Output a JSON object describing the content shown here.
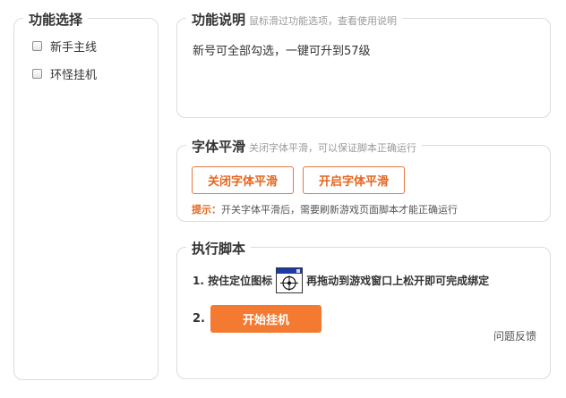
{
  "features": {
    "title": "功能选择",
    "items": [
      {
        "label": "新手主线",
        "checked": false
      },
      {
        "label": "环怪挂机",
        "checked": false
      }
    ]
  },
  "description": {
    "title": "功能说明",
    "subtitle": "鼠标滑过功能选项，查看使用说明",
    "text": "新号可全部勾选，一键可升到57级"
  },
  "font_smoothing": {
    "title": "字体平滑",
    "subtitle": "关闭字体平滑，可以保证脚本正确运行",
    "close_label": "关闭字体平滑",
    "open_label": "开启字体平滑",
    "tip_label": "提示：",
    "tip_text": "开关字体平滑后，需要刷新游戏页面脚本才能正确运行",
    "accent_color": "#e5661f"
  },
  "run_script": {
    "title": "执行脚本",
    "step1_prefix": "1. 按住定位图标",
    "step1_suffix": "再拖动到游戏窗口上松开即可完成绑定",
    "locator_icon": "crosshair-target-icon",
    "step2_num": "2.",
    "start_label": "开始挂机",
    "feedback_label": "问题反馈",
    "primary_color": "#f47a31"
  }
}
